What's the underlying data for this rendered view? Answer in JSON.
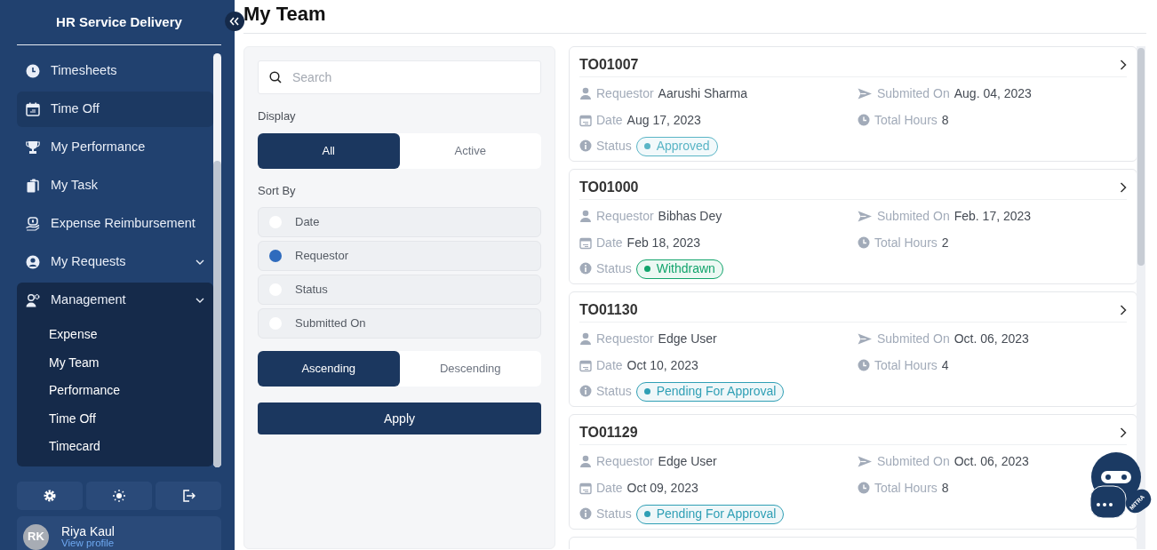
{
  "sidebar": {
    "title": "HR Service Delivery",
    "items": [
      {
        "label": "Timesheets",
        "kind": "link",
        "selected": false
      },
      {
        "label": "Time Off",
        "kind": "link",
        "selected": true
      },
      {
        "label": "My Performance",
        "kind": "link",
        "selected": false
      },
      {
        "label": "My Task",
        "kind": "link",
        "selected": false
      },
      {
        "label": "Expense Reimbursement",
        "kind": "link",
        "selected": false
      },
      {
        "label": "My Requests",
        "kind": "group",
        "selected": false,
        "expanded": false
      },
      {
        "label": "Management",
        "kind": "group",
        "selected": false,
        "expanded": true,
        "children": [
          {
            "label": "Expense",
            "selected": false
          },
          {
            "label": "My Team",
            "selected": false
          },
          {
            "label": "Performance",
            "selected": false
          },
          {
            "label": "Time Off",
            "selected": false
          },
          {
            "label": "Timecard",
            "selected": false
          }
        ]
      }
    ],
    "user": {
      "initials": "RK",
      "name": "Riya Kaul",
      "link": "View profile"
    }
  },
  "page_title": "My Team",
  "filters": {
    "search": {
      "placeholder": "Search"
    },
    "display_label": "Display",
    "display_options": [
      {
        "label": "All",
        "selected": true
      },
      {
        "label": "Active",
        "selected": false
      }
    ],
    "sort_label": "Sort By",
    "sort_options": [
      {
        "label": "Date",
        "selected": false
      },
      {
        "label": "Requestor",
        "selected": true
      },
      {
        "label": "Status",
        "selected": false
      },
      {
        "label": "Submitted On",
        "selected": false
      }
    ],
    "order_options": [
      {
        "label": "Ascending",
        "selected": true
      },
      {
        "label": "Descending",
        "selected": false
      }
    ],
    "apply": "Apply"
  },
  "requests": [
    {
      "id": "TO01007",
      "requestor_label": "Requestor",
      "requestor": "Aarushi Sharma",
      "submitted_label": "Submited On",
      "submitted": "Aug. 04, 2023",
      "date_label": "Date",
      "date": "Aug 17, 2023",
      "hours_label": "Total Hours",
      "hours": "8",
      "status_label": "Status",
      "status": "Approved",
      "color": "#5ab5c6"
    },
    {
      "id": "TO01000",
      "requestor_label": "Requestor",
      "requestor": "Bibhas Dey",
      "submitted_label": "Submited On",
      "submitted": "Feb. 17, 2023",
      "date_label": "Date",
      "date": "Feb 18, 2023",
      "hours_label": "Total Hours",
      "hours": "2",
      "status_label": "Status",
      "status": "Withdrawn",
      "color": "#12a46c"
    },
    {
      "id": "TO01130",
      "requestor_label": "Requestor",
      "requestor": "Edge User",
      "submitted_label": "Submited On",
      "submitted": "Oct. 06, 2023",
      "date_label": "Date",
      "date": "Oct 10, 2023",
      "hours_label": "Total Hours",
      "hours": "4",
      "status_label": "Status",
      "status": "Pending For Approval",
      "color": "#2f9fb5"
    },
    {
      "id": "TO01129",
      "requestor_label": "Requestor",
      "requestor": "Edge User",
      "submitted_label": "Submited On",
      "submitted": "Oct. 06, 2023",
      "date_label": "Date",
      "date": "Oct 09, 2023",
      "hours_label": "Total Hours",
      "hours": "8",
      "status_label": "Status",
      "status": "Pending For Approval",
      "color": "#2f9fb5"
    }
  ],
  "chatbot": {
    "label": "MITRA"
  }
}
